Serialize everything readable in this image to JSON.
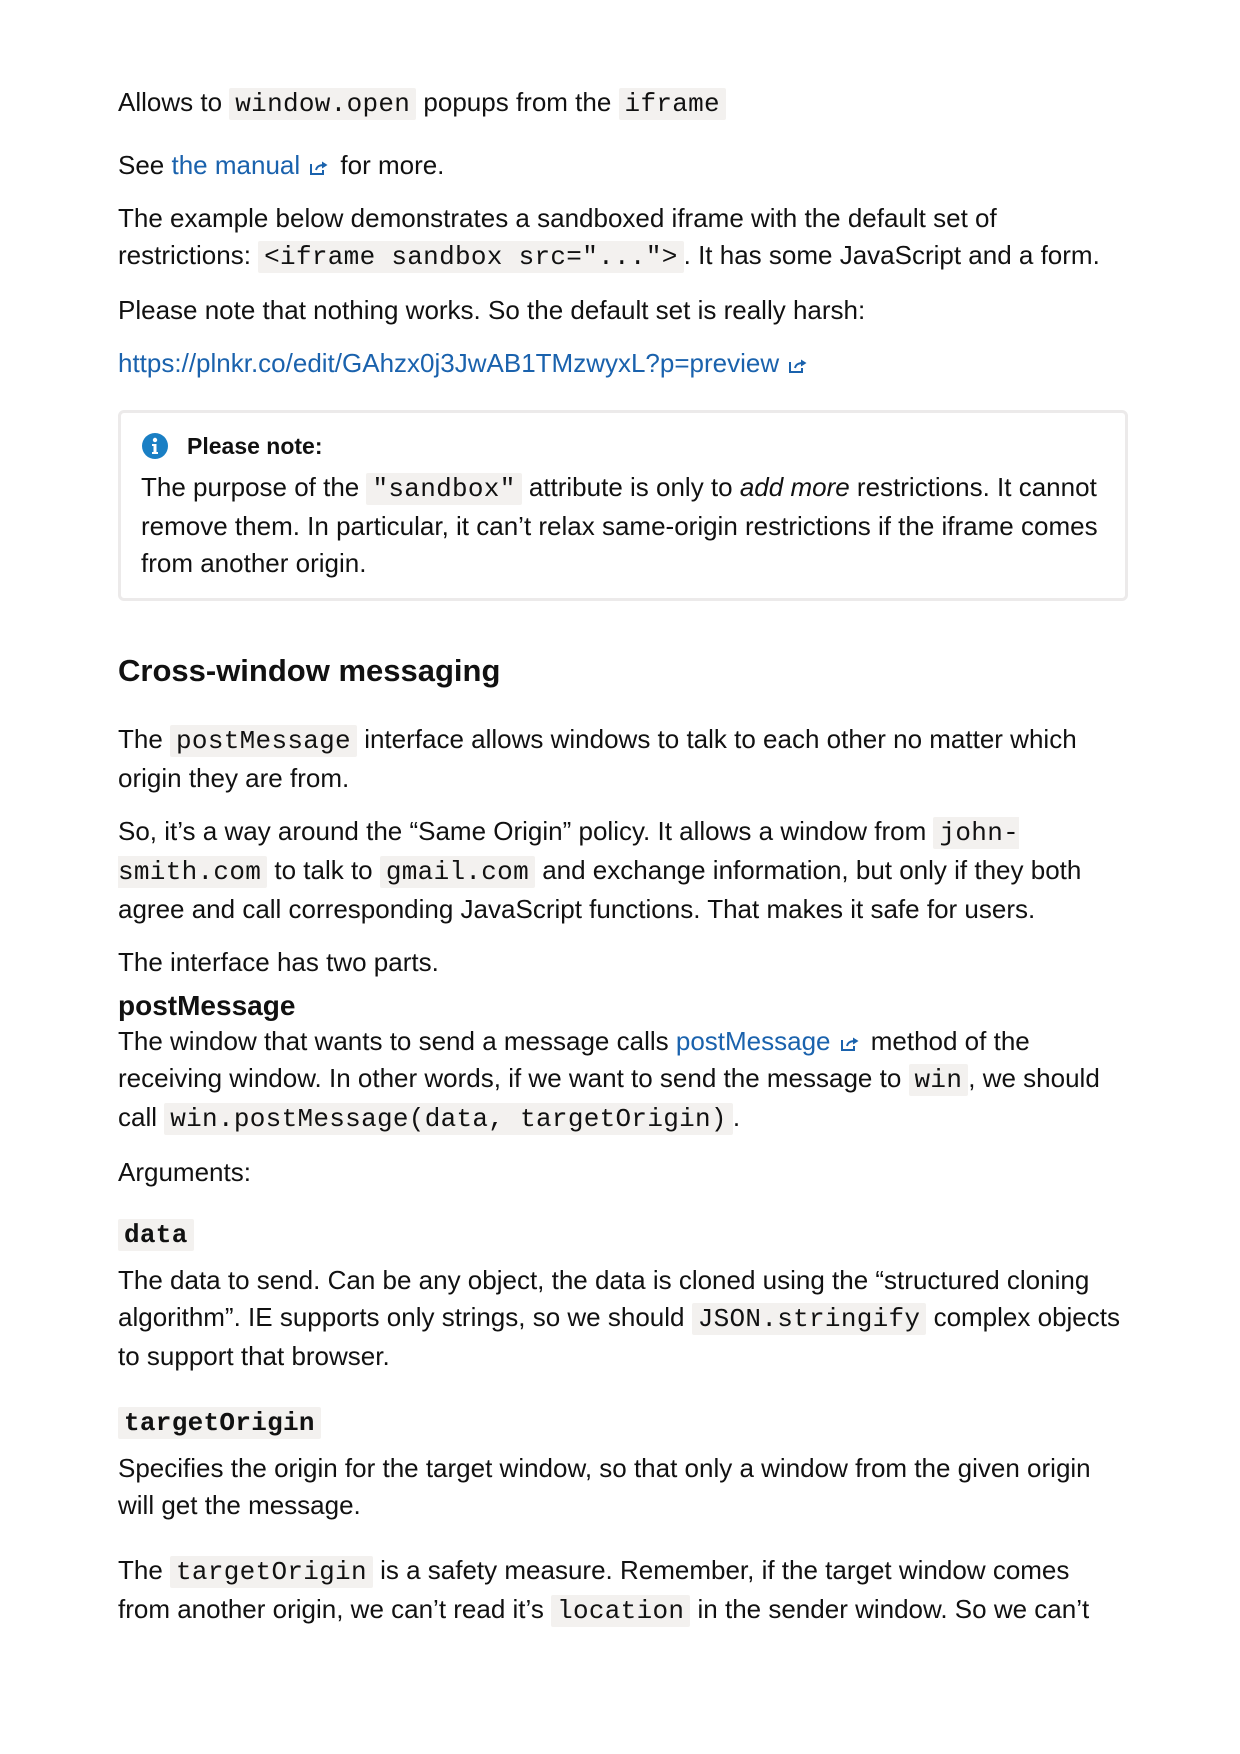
{
  "sandbox_popups": {
    "prefix": "Allows to ",
    "code1": "window.open",
    "middle": " popups from the ",
    "code2": "iframe"
  },
  "see_manual": {
    "prefix": "See ",
    "link": "the manual",
    "suffix": " for more."
  },
  "example_para": {
    "text1": "The example below demonstrates a sandboxed iframe with the default set of restrictions: ",
    "code": "<iframe sandbox src=\"...\">",
    "text2": ". It has some JavaScript and a form."
  },
  "harsh_para": "Please note that nothing works. So the default set is really harsh:",
  "plunker_link": "https://plnkr.co/edit/GAhzx0j3JwAB1TMzwyxL?p=preview",
  "note": {
    "title": "Please note:",
    "text1": "The purpose of the ",
    "code": "\"sandbox\"",
    "text2": " attribute is only to ",
    "emph": "add more",
    "text3": " restrictions. It cannot remove them. In particular, it can’t relax same-origin restrictions if the iframe comes from another origin."
  },
  "section_heading": "Cross-window messaging",
  "intro_para": {
    "text1": "The ",
    "code": "postMessage",
    "text2": " interface allows windows to talk to each other no matter which origin they are from."
  },
  "policy_para": {
    "text1": "So, it’s a way around the “Same Origin” policy. It allows a window from ",
    "code1": "john-smith.com",
    "text2": " to talk to ",
    "code2": "gmail.com",
    "text3": " and exchange information, but only if they both agree and call corresponding JavaScript functions. That makes it safe for users."
  },
  "parts_para": "The interface has two parts.",
  "sub_heading": "postMessage",
  "send_para": {
    "text1": "The window that wants to send a message calls ",
    "link": "postMessage",
    "text2": " method of the receiving window. In other words, if we want to send the message to ",
    "code1": "win",
    "text3": ", we should call ",
    "code2": "win.postMessage(data, targetOrigin)",
    "text4": "."
  },
  "arguments_label": "Arguments:",
  "arg_data": {
    "term": "data",
    "text1": "The data to send. Can be any object, the data is cloned using the “structured cloning algorithm”. IE supports only strings, so we should ",
    "code": "JSON.stringify",
    "text2": " complex objects to support that browser."
  },
  "arg_target": {
    "term": "targetOrigin",
    "text": "Specifies the origin for the target window, so that only a window from the given origin will get the message."
  },
  "safety_para": {
    "text1": "The ",
    "code1": "targetOrigin",
    "text2": " is a safety measure. Remember, if the target window comes from another origin, we can’t read it’s ",
    "code2": "location",
    "text3": " in the sender window. So we can’t"
  },
  "colors": {
    "link": "#1a62ad",
    "info_icon": "#1a7fc4",
    "code_bg": "#f3f1ef",
    "note_border": "#eceaea"
  }
}
